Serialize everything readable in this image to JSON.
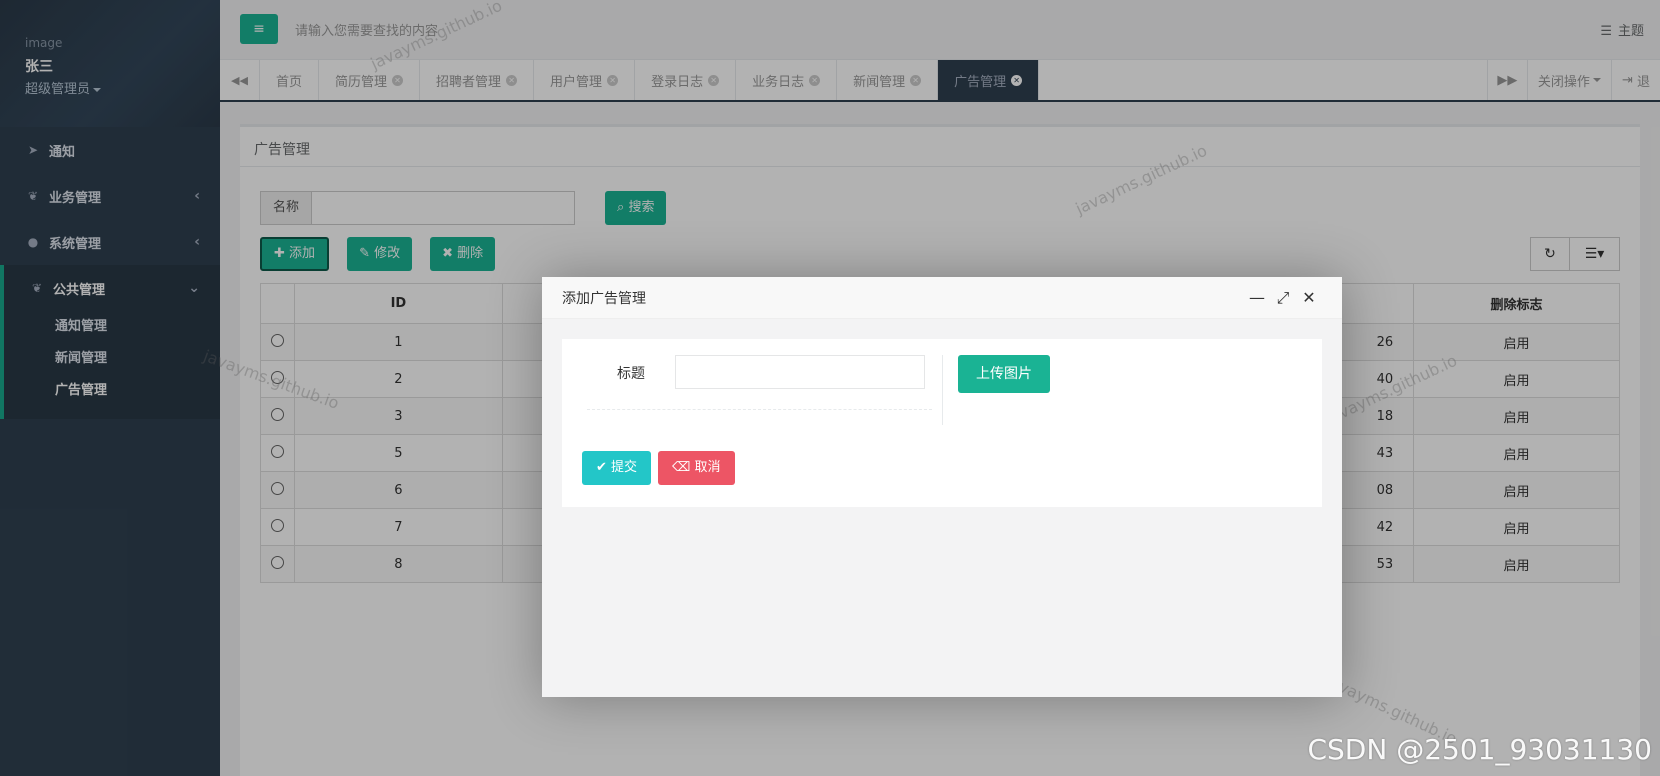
{
  "sidebar": {
    "profile": {
      "image_alt": "image",
      "name": "张三",
      "role": "超级管理员"
    },
    "items": [
      {
        "label": "通知",
        "icon": "paper-plane-icon"
      },
      {
        "label": "业务管理",
        "icon": "leaf-icon"
      },
      {
        "label": "系统管理",
        "icon": "user-icon"
      }
    ],
    "active_group": {
      "label": "公共管理",
      "icon": "leaf-icon",
      "children": [
        "通知管理",
        "新闻管理",
        "广告管理"
      ]
    }
  },
  "topbar": {
    "search_placeholder": "请输入您需要查找的内容",
    "theme_label": "主题"
  },
  "tabs": {
    "items": [
      {
        "label": "首页",
        "closable": false
      },
      {
        "label": "简历管理",
        "closable": true
      },
      {
        "label": "招聘者管理",
        "closable": true
      },
      {
        "label": "用户管理",
        "closable": true
      },
      {
        "label": "登录日志",
        "closable": true
      },
      {
        "label": "业务日志",
        "closable": true
      },
      {
        "label": "新闻管理",
        "closable": true
      },
      {
        "label": "广告管理",
        "closable": true,
        "active": true
      }
    ],
    "close_ops_label": "关闭操作",
    "logout_label": "退"
  },
  "main": {
    "panel_title": "广告管理",
    "search_label": "名称",
    "search_button": "搜索",
    "toolbar": {
      "add": "添加",
      "edit": "修改",
      "delete": "删除"
    },
    "table": {
      "headers": [
        "",
        "ID",
        "删除标志"
      ],
      "rows": [
        {
          "id": "1",
          "partial": "26",
          "flag": "启用"
        },
        {
          "id": "2",
          "partial": "40",
          "flag": "启用"
        },
        {
          "id": "3",
          "partial": "18",
          "flag": "启用"
        },
        {
          "id": "5",
          "partial": "43",
          "flag": "启用"
        },
        {
          "id": "6",
          "partial": "08",
          "flag": "启用"
        },
        {
          "id": "7",
          "partial": "42",
          "flag": "启用"
        },
        {
          "id": "8",
          "partial": "53",
          "flag": "启用"
        }
      ]
    }
  },
  "modal": {
    "title": "添加广告管理",
    "field_label": "标题",
    "field_value": "",
    "upload_button": "上传图片",
    "submit_button": "提交",
    "cancel_button": "取消"
  },
  "watermark": {
    "text": "javayms.github.io",
    "csdn": "CSDN @2501_93031130"
  },
  "colors": {
    "primary": "#1ab394",
    "sidebar": "#2f4050",
    "info": "#23c6c8",
    "danger": "#ed5565"
  }
}
